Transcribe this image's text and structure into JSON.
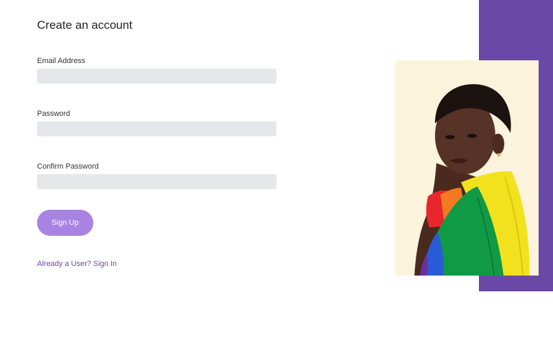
{
  "form": {
    "title": "Create an account",
    "email": {
      "label": "Email Address",
      "value": "",
      "placeholder": ""
    },
    "password": {
      "label": "Password",
      "value": "",
      "placeholder": ""
    },
    "confirm_password": {
      "label": "Confirm Password",
      "value": "",
      "placeholder": ""
    },
    "signup_label": "Sign Up",
    "signin_link": "Already a User? Sign In"
  },
  "colors": {
    "accent_button": "#a983e3",
    "accent_band": "#6a48a8",
    "link": "#6e45b0",
    "input_background": "#e6e7ea",
    "photo_background": "#fbf3dc"
  },
  "hero_image": {
    "subject": "person wrapped in rainbow pride flag"
  }
}
